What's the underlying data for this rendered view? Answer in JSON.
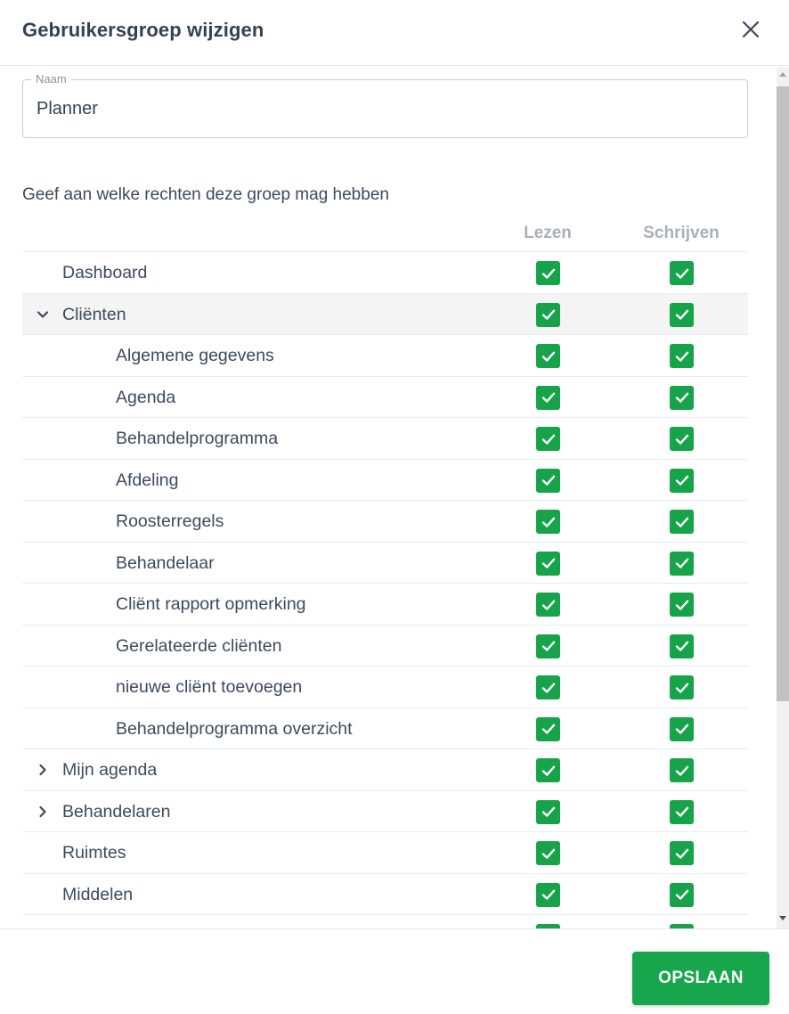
{
  "dialog": {
    "title": "Gebruikersgroep wijzigen",
    "close_icon": "close-icon"
  },
  "name_field": {
    "label": "Naam",
    "value": "Planner"
  },
  "permissions": {
    "description": "Geef aan welke rechten deze groep mag hebben",
    "columns": {
      "read": "Lezen",
      "write": "Schrijven"
    },
    "rows": [
      {
        "label": "Dashboard",
        "level": 0,
        "toggle": null,
        "read": true,
        "write": true
      },
      {
        "label": "Cliënten",
        "level": 0,
        "toggle": "expanded",
        "read": true,
        "write": true,
        "active": true
      },
      {
        "label": "Algemene gegevens",
        "level": 1,
        "toggle": null,
        "read": true,
        "write": true
      },
      {
        "label": "Agenda",
        "level": 1,
        "toggle": null,
        "read": true,
        "write": true
      },
      {
        "label": "Behandelprogramma",
        "level": 1,
        "toggle": null,
        "read": true,
        "write": true
      },
      {
        "label": "Afdeling",
        "level": 1,
        "toggle": null,
        "read": true,
        "write": true
      },
      {
        "label": "Roosterregels",
        "level": 1,
        "toggle": null,
        "read": true,
        "write": true
      },
      {
        "label": "Behandelaar",
        "level": 1,
        "toggle": null,
        "read": true,
        "write": true
      },
      {
        "label": "Cliënt rapport opmerking",
        "level": 1,
        "toggle": null,
        "read": true,
        "write": true
      },
      {
        "label": "Gerelateerde cliënten",
        "level": 1,
        "toggle": null,
        "read": true,
        "write": true
      },
      {
        "label": "nieuwe cliënt toevoegen",
        "level": 1,
        "toggle": null,
        "read": true,
        "write": true
      },
      {
        "label": "Behandelprogramma overzicht",
        "level": 1,
        "toggle": null,
        "read": true,
        "write": true
      },
      {
        "label": "Mijn agenda",
        "level": 0,
        "toggle": "collapsed",
        "read": true,
        "write": true
      },
      {
        "label": "Behandelaren",
        "level": 0,
        "toggle": "collapsed",
        "read": true,
        "write": true
      },
      {
        "label": "Ruimtes",
        "level": 0,
        "toggle": null,
        "read": true,
        "write": true
      },
      {
        "label": "Middelen",
        "level": 0,
        "toggle": null,
        "read": true,
        "write": true
      },
      {
        "label": "",
        "level": 0,
        "toggle": null,
        "read": true,
        "write": true
      }
    ]
  },
  "footer": {
    "save_label": "OPSLAAN"
  },
  "colors": {
    "accent_green": "#18a64c",
    "checkbox_green": "#16a34a",
    "text": "#3d4a5c",
    "muted": "#a9b0ba"
  }
}
